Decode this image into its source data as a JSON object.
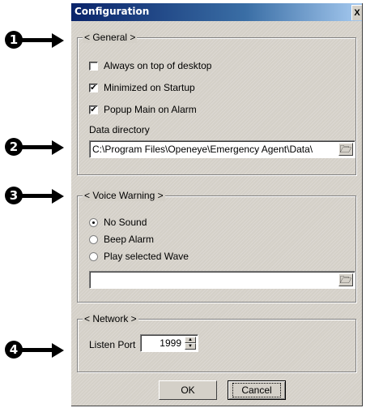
{
  "window": {
    "title": "Configuration",
    "close_label": "X"
  },
  "callouts": [
    "1",
    "2",
    "3",
    "4"
  ],
  "general": {
    "legend": "< General >",
    "options": [
      {
        "label": "Always on top of desktop",
        "checked": false
      },
      {
        "label": "Minimized on Startup",
        "checked": true
      },
      {
        "label": "Popup Main on Alarm",
        "checked": true
      }
    ],
    "data_directory_label": "Data directory",
    "data_directory_value": "C:\\Program Files\\Openeye\\Emergency Agent\\Data\\"
  },
  "voice_warning": {
    "legend": "< Voice Warning >",
    "options": [
      {
        "label": "No Sound",
        "selected": true
      },
      {
        "label": "Beep Alarm",
        "selected": false
      },
      {
        "label": "Play selected Wave",
        "selected": false
      }
    ],
    "wave_file_value": ""
  },
  "network": {
    "legend": "< Network >",
    "listen_port_label": "Listen Port",
    "listen_port_value": "1999"
  },
  "buttons": {
    "ok": "OK",
    "cancel": "Cancel"
  },
  "icons": {
    "browse": "folder-browse-icon",
    "checkmark": "✔"
  },
  "colors": {
    "dialog_bg": "#d4d0c8",
    "title_start": "#0a246a",
    "title_end": "#a6caf0"
  }
}
